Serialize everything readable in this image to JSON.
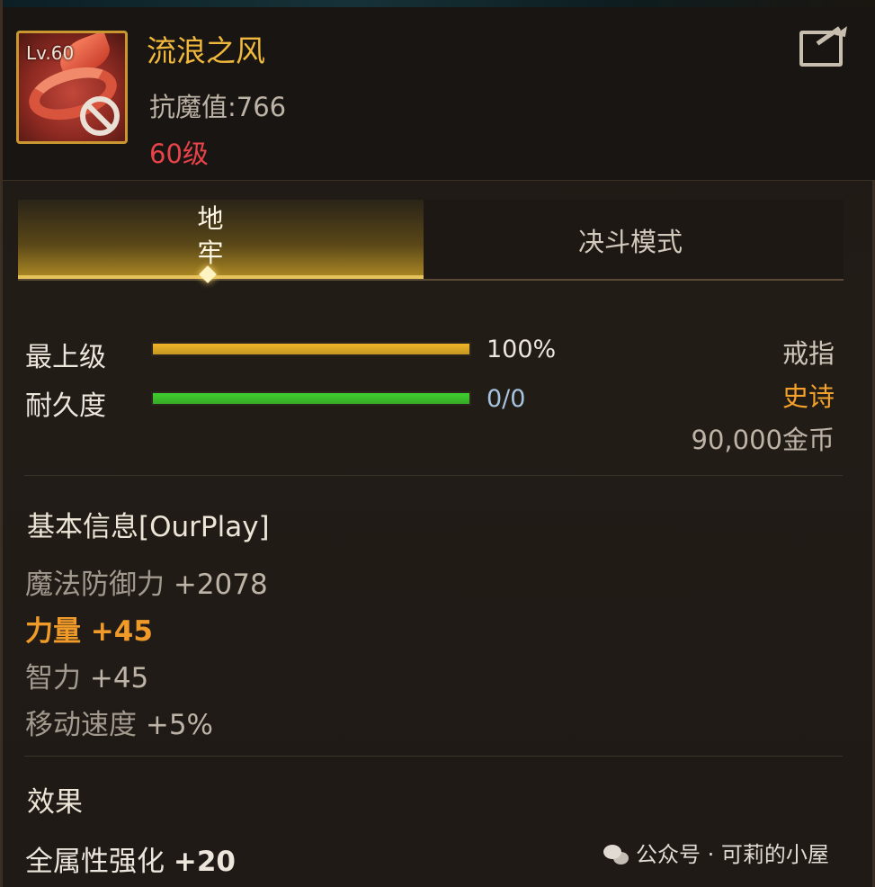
{
  "item": {
    "level_badge": "Lv.60",
    "name": "流浪之风",
    "stat_line": "抗魔值:766",
    "required_level": "60级"
  },
  "tabs": [
    {
      "label_top": "地",
      "label_bottom": "牢",
      "active": true
    },
    {
      "label": "决斗模式",
      "active": false
    }
  ],
  "bars": [
    {
      "label": "最上级",
      "value_text": "100%",
      "fraction": 1.0,
      "color": "#f0b627"
    },
    {
      "label": "耐久度",
      "value_text": "0/0",
      "fraction": 1.0,
      "color": "#3fcf2e"
    }
  ],
  "side_info": {
    "type": "戒指",
    "rarity": "史诗",
    "price": "90,000金币",
    "rarity_color": "#f3a12b"
  },
  "basic_info": {
    "title": "基本信息[OurPlay]",
    "attributes": [
      {
        "name": "魔法防御力",
        "value": "+2078",
        "style": "normal"
      },
      {
        "name": "力量",
        "value": "+45",
        "style": "highlight"
      },
      {
        "name": "智力",
        "value": "+45",
        "style": "normal"
      },
      {
        "name": "移动速度",
        "value": "+5%",
        "style": "normal"
      }
    ]
  },
  "effects": {
    "title": "效果",
    "attributes": [
      {
        "name": "全属性强化",
        "value": "+20",
        "style": "bright"
      }
    ]
  },
  "watermark": "公众号 · 可莉的小屋",
  "icons": {
    "item": "ring-bracelet-icon",
    "restricted": "no-trade-icon",
    "share": "share-icon",
    "wechat": "wechat-icon"
  }
}
